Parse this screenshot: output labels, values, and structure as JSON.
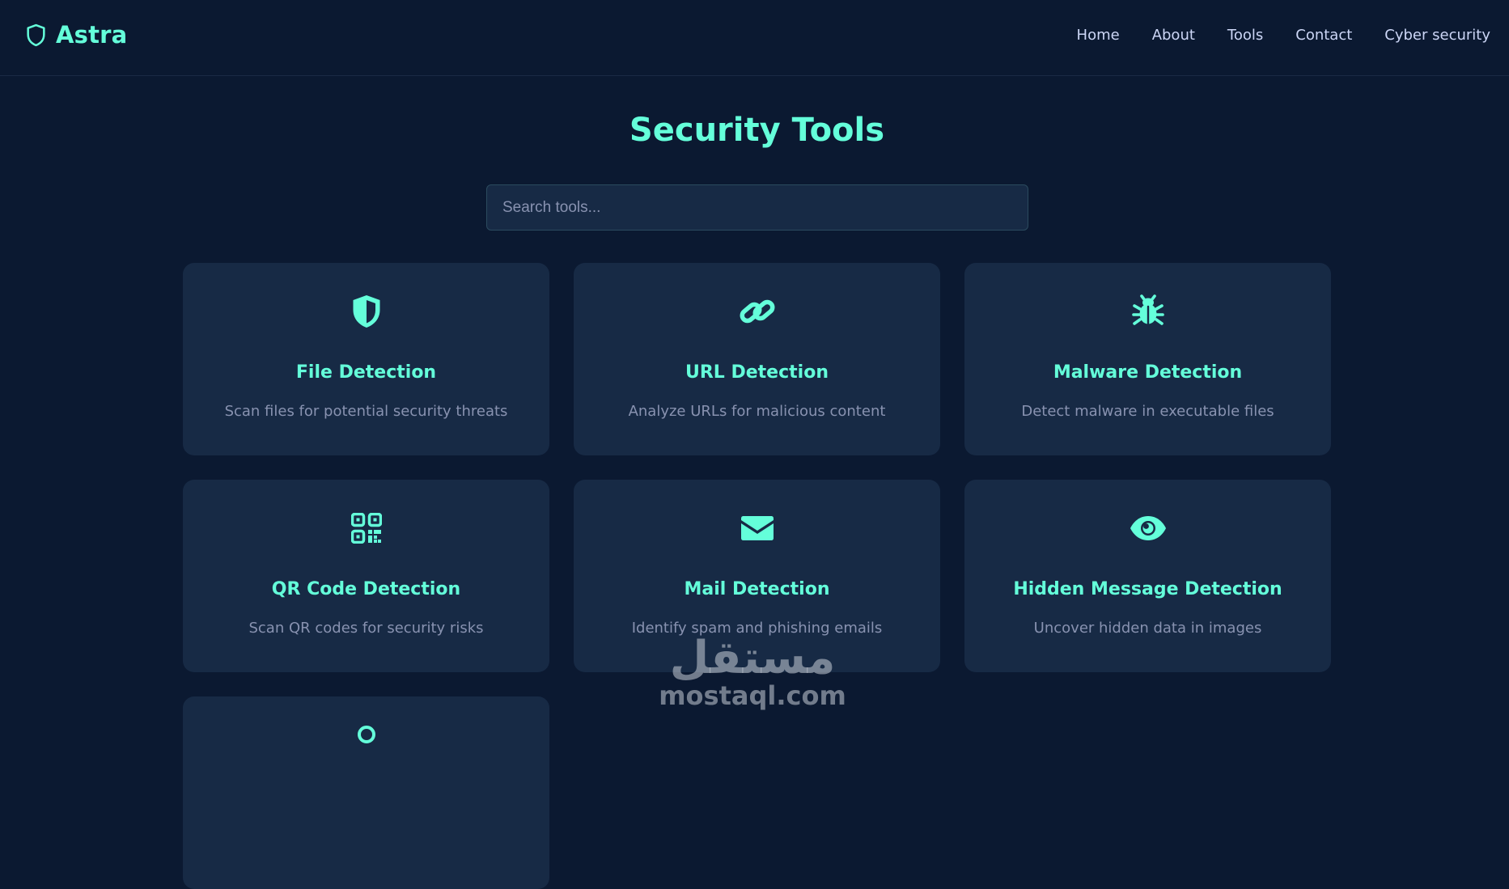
{
  "brand": {
    "name": "Astra",
    "icon": "shield-outline-icon"
  },
  "nav": {
    "items": [
      {
        "label": "Home"
      },
      {
        "label": "About"
      },
      {
        "label": "Tools"
      },
      {
        "label": "Contact"
      },
      {
        "label": "Cyber security"
      }
    ]
  },
  "page": {
    "title": "Security Tools"
  },
  "search": {
    "placeholder": "Search tools...",
    "value": ""
  },
  "tools": [
    {
      "title": "File Detection",
      "description": "Scan files for potential security threats",
      "icon": "shield-icon"
    },
    {
      "title": "URL Detection",
      "description": "Analyze URLs for malicious content",
      "icon": "link-icon"
    },
    {
      "title": "Malware Detection",
      "description": "Detect malware in executable files",
      "icon": "bug-icon"
    },
    {
      "title": "QR Code Detection",
      "description": "Scan QR codes for security risks",
      "icon": "qrcode-icon"
    },
    {
      "title": "Mail Detection",
      "description": "Identify spam and phishing emails",
      "icon": "envelope-icon"
    },
    {
      "title": "Hidden Message Detection",
      "description": "Uncover hidden data in images",
      "icon": "eye-icon"
    }
  ],
  "watermark": {
    "arabic": "مستقل",
    "latin": "mostaql.com"
  },
  "colors": {
    "background": "#0b1931",
    "card": "#172a45",
    "accent": "#64ffda",
    "text": "#ccd6f6",
    "muted": "#8892b0"
  }
}
